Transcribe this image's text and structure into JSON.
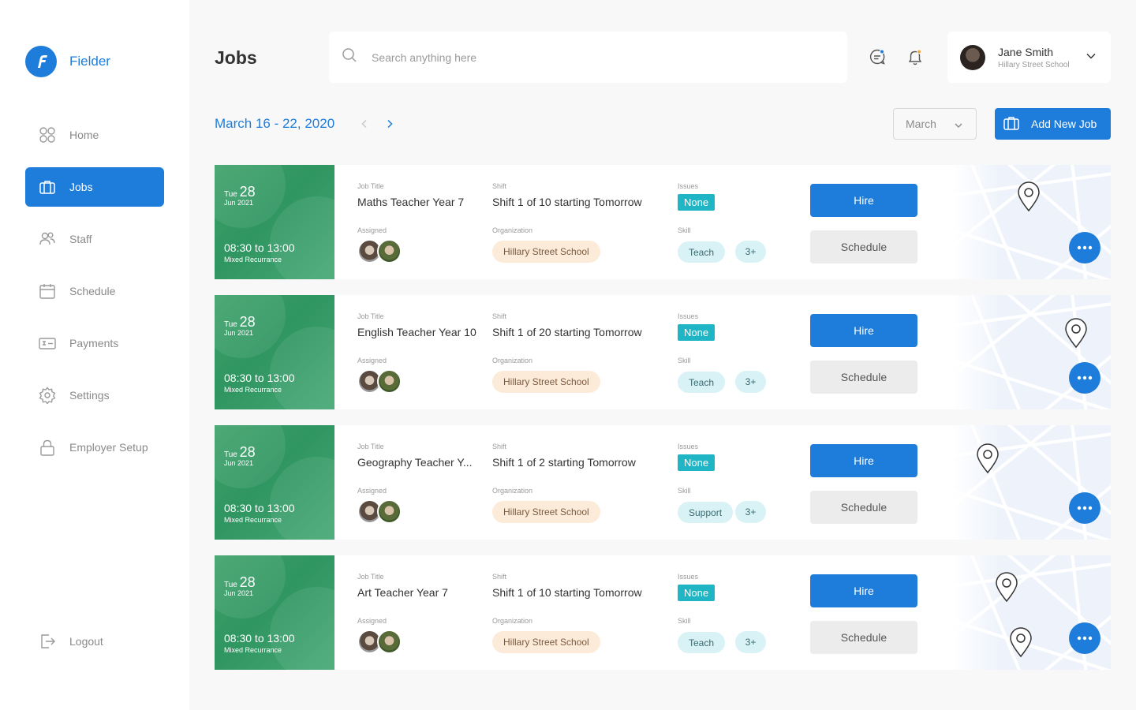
{
  "brand": {
    "name": "Fielder"
  },
  "sidebar": {
    "items": [
      {
        "label": "Home",
        "icon": "home-grid-icon"
      },
      {
        "label": "Jobs",
        "icon": "briefcase-icon",
        "active": true
      },
      {
        "label": "Staff",
        "icon": "users-icon"
      },
      {
        "label": "Schedule",
        "icon": "calendar-icon"
      },
      {
        "label": "Payments",
        "icon": "payment-card-icon"
      },
      {
        "label": "Settings",
        "icon": "gear-icon"
      },
      {
        "label": "Employer Setup",
        "icon": "lock-icon"
      }
    ],
    "logout": {
      "label": "Logout",
      "icon": "logout-icon"
    }
  },
  "header": {
    "title": "Jobs",
    "search": {
      "placeholder": "Search anything here",
      "value": ""
    },
    "user": {
      "name": "Jane Smith",
      "organization": "Hillary Street School"
    }
  },
  "toolbar": {
    "date_range": "March 16 - 22, 2020",
    "month": "March",
    "add_job_label": "Add New Job"
  },
  "labels": {
    "job_title": "Job Title",
    "shift": "Shift",
    "issues": "Issues",
    "assigned": "Assigned",
    "organization": "Organization",
    "skill": "Skill",
    "hire": "Hire",
    "schedule": "Schedule"
  },
  "jobs": [
    {
      "day": "Tue",
      "date": "28",
      "month_year": "Jun 2021",
      "time": "08:30 to 13:00",
      "recurrence": "Mixed Recurrance",
      "title": "Maths Teacher Year 7",
      "shift": "Shift 1 of 10 starting Tomorrow",
      "issues": "None",
      "organization": "Hillary Street School",
      "skill": "Teach",
      "skill_more": "3+"
    },
    {
      "day": "Tue",
      "date": "28",
      "month_year": "Jun 2021",
      "time": "08:30 to 13:00",
      "recurrence": "Mixed Recurrance",
      "title": "English Teacher Year 10",
      "shift": "Shift 1 of 20 starting Tomorrow",
      "issues": "None",
      "organization": "Hillary Street School",
      "skill": "Teach",
      "skill_more": "3+"
    },
    {
      "day": "Tue",
      "date": "28",
      "month_year": "Jun 2021",
      "time": "08:30 to 13:00",
      "recurrence": "Mixed Recurrance",
      "title": "Geography Teacher Y...",
      "shift": "Shift 1 of 2 starting Tomorrow",
      "issues": "None",
      "organization": "Hillary Street School",
      "skill": "Support",
      "skill_more": "3+"
    },
    {
      "day": "Tue",
      "date": "28",
      "month_year": "Jun 2021",
      "time": "08:30 to 13:00",
      "recurrence": "Mixed Recurrance",
      "title": "Art Teacher Year 7",
      "shift": "Shift 1 of 10 starting Tomorrow",
      "issues": "None",
      "organization": "Hillary Street School",
      "skill": "Teach",
      "skill_more": "3+"
    }
  ],
  "colors": {
    "accent": "#1e7ddb",
    "date_panel": "#3a9e67",
    "issue_badge": "#1fb5c4",
    "org_pill": "#fdebd9",
    "skill_pill": "#d9f2f6"
  }
}
